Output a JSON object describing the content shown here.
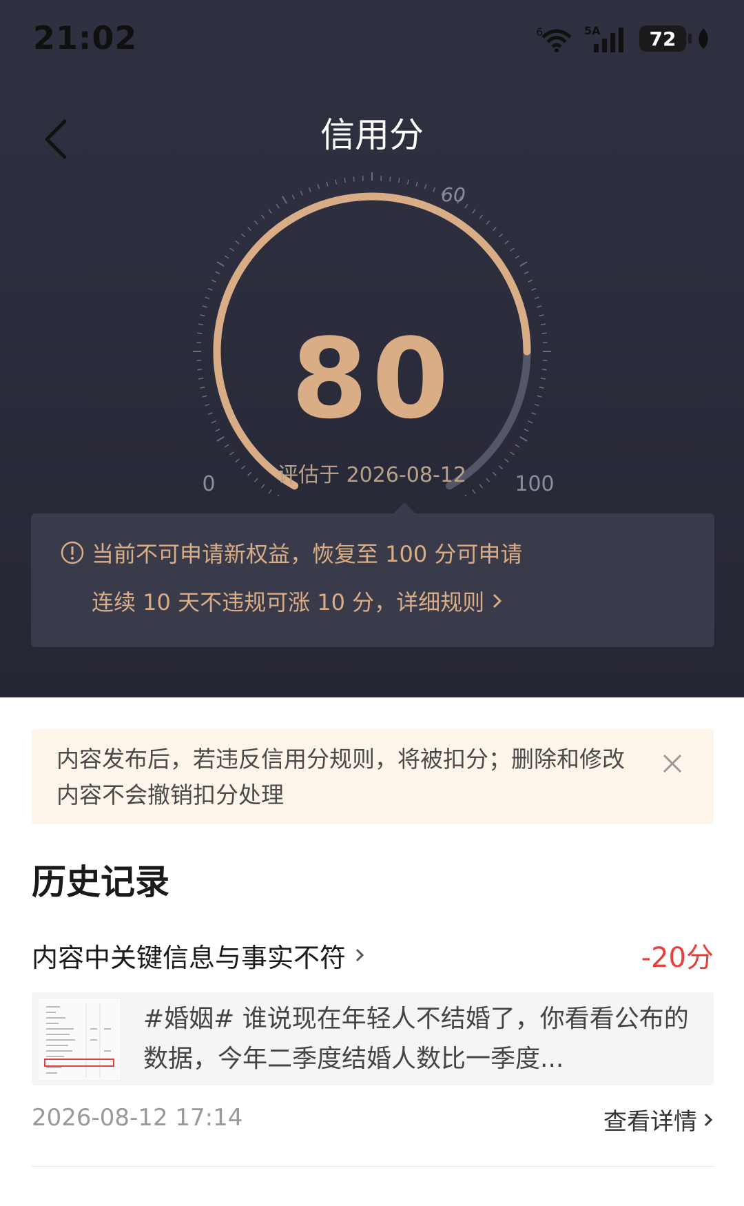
{
  "status_bar": {
    "time": "21:02",
    "wifi_label": "6",
    "signal_label": "5A",
    "battery": "72"
  },
  "header": {
    "title": "信用分"
  },
  "gauge": {
    "score": "80",
    "score_value": 80,
    "min_label": "0",
    "mid_label": "60",
    "max_label": "100",
    "eval_date": "评估于 2026-08-12",
    "color_filled": "#d9ad86",
    "color_track": "#55566a"
  },
  "notice": {
    "line1": "当前不可申请新权益，恢复至 100 分可申请",
    "line2": "连续 10 天不违规可涨 10 分，详细规则"
  },
  "tip": {
    "text": "内容发布后，若违反信用分规则，将被扣分；删除和修改内容不会撤销扣分处理"
  },
  "history": {
    "title": "历史记录",
    "records": [
      {
        "reason": "内容中关键信息与事实不符",
        "score": "-20分",
        "content": "#婚姻# 谁说现在年轻人不结婚了，你看看公布的数据，今年二季度结婚人数比一季度...",
        "time": "2026-08-12 17:14",
        "action": "查看详情"
      }
    ]
  }
}
